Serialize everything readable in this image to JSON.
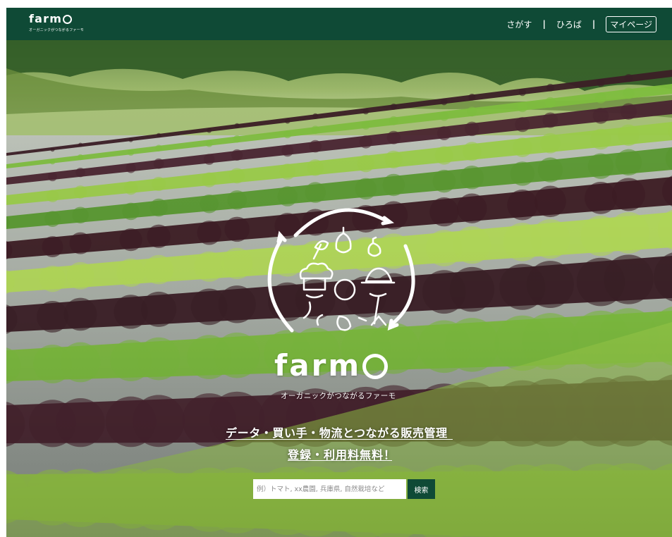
{
  "header": {
    "logo_text": "farm",
    "logo_tagline": "オーガニックがつながるファーモ",
    "nav": {
      "search": "さがす",
      "separator": "|",
      "plaza": "ひろば",
      "mypage": "マイページ"
    }
  },
  "hero": {
    "brand_text": "farm",
    "brand_tagline": "オーガニックがつながるファーモ",
    "copy_line1": "データ・買い手・物流とつながる販売管理",
    "copy_line2": "登録・利用料無料！"
  },
  "search": {
    "placeholder": "例）トマト, xx農園, 兵庫県, 自然栽培など",
    "button_label": "検索"
  },
  "colors": {
    "brand_green": "#0f4a36",
    "white": "#ffffff"
  }
}
